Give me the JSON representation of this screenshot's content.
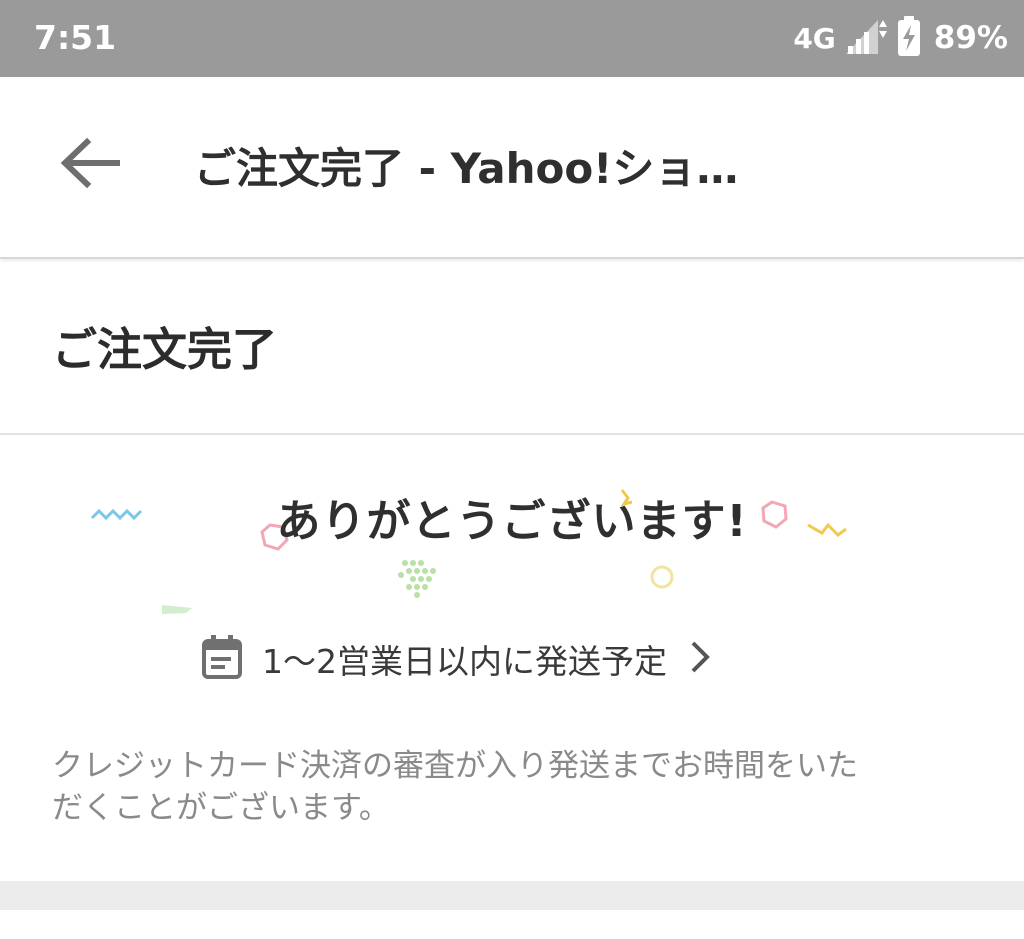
{
  "status_bar": {
    "time": "7:51",
    "network": "4G",
    "battery": "89%"
  },
  "app_bar": {
    "title": "ご注文完了 - Yahoo!ショ…",
    "back_icon": "arrow-back-icon"
  },
  "page": {
    "title": "ご注文完了",
    "thanks_message": "ありがとうございます!",
    "shipping": {
      "icon": "calendar-icon",
      "text": "1〜2営業日以内に発送予定",
      "chevron": "chevron-right-icon"
    },
    "note_line1": "クレジットカード決済の審査が入り発送までお時間をいた",
    "note_line2": "だくことがございます。"
  },
  "colors": {
    "status_bar_bg": "#9a9a9a",
    "title_text": "#2f2f2f",
    "muted_text": "#8a8a8a"
  }
}
